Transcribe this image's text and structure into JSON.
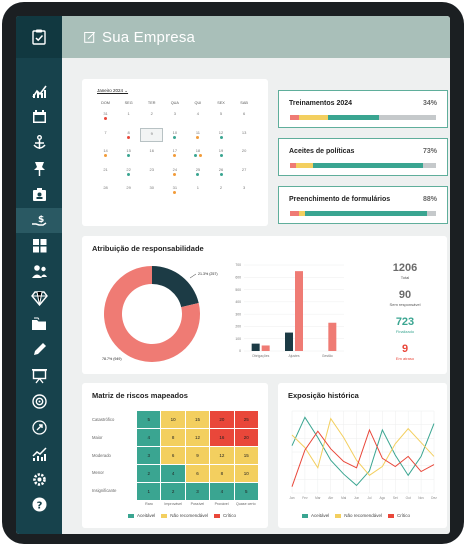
{
  "app": {
    "title": "Sua Empresa"
  },
  "colors": {
    "teal": "#3aa591",
    "dark": "#1c3b45",
    "coral": "#ef7b74",
    "yellow": "#f3cf5f",
    "red": "#e9473a",
    "orange": "#f29b39",
    "grey": "#c5c9cb",
    "sidebar": "#17424c"
  },
  "sidebar": {
    "items": [
      {
        "icon": "bar-chart-icon"
      },
      {
        "icon": "calendar-icon"
      },
      {
        "icon": "anchor-icon"
      },
      {
        "icon": "pin-icon"
      },
      {
        "icon": "id-badge-icon"
      },
      {
        "icon": "hand-money-icon"
      },
      {
        "icon": "grid-icon"
      },
      {
        "icon": "users-icon"
      },
      {
        "icon": "diamond-icon"
      },
      {
        "icon": "folders-icon"
      },
      {
        "icon": "pen-icon"
      },
      {
        "icon": "presentation-icon"
      },
      {
        "icon": "target-icon"
      },
      {
        "icon": "rocket-icon"
      },
      {
        "icon": "analytics-icon"
      },
      {
        "icon": "settings-icon"
      },
      {
        "icon": "help-icon"
      }
    ]
  },
  "calendar": {
    "month_label": "Janeiro 2024",
    "weekdays": [
      "DOM",
      "SEG",
      "TER",
      "QUA",
      "QUI",
      "SEX",
      "SAB"
    ],
    "weeks": [
      [
        {
          "d": "31",
          "m": [
            "#e9473a"
          ]
        },
        {
          "d": "1"
        },
        {
          "d": "2"
        },
        {
          "d": "3"
        },
        {
          "d": "4"
        },
        {
          "d": "5"
        },
        {
          "d": "6"
        }
      ],
      [
        {
          "d": "7"
        },
        {
          "d": "8",
          "m": [
            "#e9473a"
          ]
        },
        {
          "d": "9",
          "sel": true
        },
        {
          "d": "10",
          "m": [
            "#3aa591"
          ]
        },
        {
          "d": "11",
          "m": [
            "#f29b39"
          ]
        },
        {
          "d": "12",
          "m": [
            "#3aa591"
          ]
        },
        {
          "d": "13"
        }
      ],
      [
        {
          "d": "14",
          "m": [
            "#f29b39"
          ]
        },
        {
          "d": "15",
          "m": [
            "#3aa591"
          ]
        },
        {
          "d": "16"
        },
        {
          "d": "17",
          "m": [
            "#f29b39"
          ]
        },
        {
          "d": "18",
          "m": [
            "#3aa591",
            "#f29b39"
          ]
        },
        {
          "d": "19",
          "m": [
            "#3aa591"
          ]
        },
        {
          "d": "20"
        }
      ],
      [
        {
          "d": "21"
        },
        {
          "d": "22",
          "m": [
            "#3aa591"
          ]
        },
        {
          "d": "23"
        },
        {
          "d": "24",
          "m": [
            "#f29b39"
          ]
        },
        {
          "d": "25",
          "m": [
            "#3aa591"
          ]
        },
        {
          "d": "26",
          "m": [
            "#3aa591"
          ]
        },
        {
          "d": "27"
        }
      ],
      [
        {
          "d": "28"
        },
        {
          "d": "29"
        },
        {
          "d": "30"
        },
        {
          "d": "31",
          "m": [
            "#f29b39"
          ]
        },
        {
          "d": "1"
        },
        {
          "d": "2"
        },
        {
          "d": "3"
        }
      ]
    ]
  },
  "progress": [
    {
      "title": "Treinamentos 2024",
      "percent": "34%",
      "segments": [
        {
          "c": "#ef7b74",
          "v": 6
        },
        {
          "c": "#f3cf5f",
          "v": 20
        },
        {
          "c": "#3aa591",
          "v": 35
        },
        {
          "c": "#c5c9cb",
          "v": 39
        }
      ]
    },
    {
      "title": "Aceites de políticas",
      "percent": "73%",
      "segments": [
        {
          "c": "#ef7b74",
          "v": 4
        },
        {
          "c": "#f3cf5f",
          "v": 12
        },
        {
          "c": "#3aa591",
          "v": 75
        },
        {
          "c": "#c5c9cb",
          "v": 9
        }
      ]
    },
    {
      "title": "Preenchimento de formulários",
      "percent": "88%",
      "segments": [
        {
          "c": "#ef7b74",
          "v": 6
        },
        {
          "c": "#f3cf5f",
          "v": 4
        },
        {
          "c": "#3aa591",
          "v": 84
        },
        {
          "c": "#c5c9cb",
          "v": 6
        }
      ]
    }
  ],
  "responsibility": {
    "title": "Atribuição de responsabilidade",
    "stats": [
      {
        "value": "1206",
        "label": "Total",
        "color": "#6b6b6b"
      },
      {
        "value": "90",
        "label": "Sem responsável",
        "color": "#6b6b6b"
      },
      {
        "value": "723",
        "label": "Finalizado",
        "color": "#3aa591"
      },
      {
        "value": "9",
        "label": "Em atraso",
        "color": "#e9473a"
      }
    ]
  },
  "chart_data": [
    {
      "type": "pie",
      "title": "",
      "slices": [
        {
          "label": "21.3% (257)",
          "value": 21.3,
          "color": "#1c3b45"
        },
        {
          "label": "78.7% (949)",
          "value": 78.7,
          "color": "#ef7b74"
        }
      ]
    },
    {
      "type": "bar",
      "categories": [
        "Obrigações",
        "Ajustes",
        "Gestão"
      ],
      "series": [
        {
          "values": [
            60,
            150,
            0
          ],
          "color": "#1c3b45"
        },
        {
          "values": [
            45,
            650,
            230
          ],
          "color": "#ef7b74"
        }
      ],
      "yticks": [
        "700",
        "600",
        "500",
        "400",
        "300",
        "200",
        "100",
        "0"
      ],
      "ylim": [
        0,
        700
      ]
    },
    {
      "type": "line",
      "title": "Exposição histórica",
      "categories": [
        "Jan",
        "Fev",
        "Mar",
        "Abr",
        "Mai",
        "Jun",
        "Jul",
        "Ago",
        "Set",
        "Out",
        "Nov",
        "Dez"
      ],
      "series": [
        {
          "name": "Aceitável",
          "color": "#3aa591",
          "values": [
            75,
            120,
            88,
            52,
            30,
            12,
            35,
            100,
            60,
            28,
            58,
            110
          ]
        },
        {
          "name": "Não recomendável",
          "color": "#f3cf5f",
          "values": [
            92,
            72,
            40,
            118,
            88,
            52,
            28,
            42,
            78,
            102,
            80,
            58
          ]
        },
        {
          "name": "Crítico",
          "color": "#e9473a",
          "values": [
            10,
            68,
            98,
            70,
            50,
            40,
            100,
            55,
            42,
            58,
            34,
            45
          ]
        }
      ],
      "ylim": [
        0,
        130
      ]
    }
  ],
  "risk_matrix": {
    "title": "Matriz de riscos mapeados",
    "rows": [
      "Catastrófico",
      "Maior",
      "Moderado",
      "Menor",
      "Insignificante"
    ],
    "cols": [
      "Raro",
      "Improvável",
      "Possível",
      "Provável",
      "Quase certo"
    ],
    "cells": [
      [
        {
          "v": "5",
          "c": "#3aa591"
        },
        {
          "v": "10",
          "c": "#f3cf5f"
        },
        {
          "v": "15",
          "c": "#f3cf5f"
        },
        {
          "v": "20",
          "c": "#e9473a"
        },
        {
          "v": "25",
          "c": "#e9473a"
        }
      ],
      [
        {
          "v": "4",
          "c": "#3aa591"
        },
        {
          "v": "8",
          "c": "#f3cf5f"
        },
        {
          "v": "12",
          "c": "#f3cf5f"
        },
        {
          "v": "16",
          "c": "#e9473a"
        },
        {
          "v": "20",
          "c": "#e9473a"
        }
      ],
      [
        {
          "v": "3",
          "c": "#3aa591"
        },
        {
          "v": "6",
          "c": "#f3cf5f"
        },
        {
          "v": "9",
          "c": "#f3cf5f"
        },
        {
          "v": "12",
          "c": "#f3cf5f"
        },
        {
          "v": "15",
          "c": "#f3cf5f"
        }
      ],
      [
        {
          "v": "2",
          "c": "#3aa591"
        },
        {
          "v": "4",
          "c": "#3aa591"
        },
        {
          "v": "6",
          "c": "#f3cf5f"
        },
        {
          "v": "8",
          "c": "#f3cf5f"
        },
        {
          "v": "10",
          "c": "#f3cf5f"
        }
      ],
      [
        {
          "v": "1",
          "c": "#3aa591"
        },
        {
          "v": "2",
          "c": "#3aa591"
        },
        {
          "v": "3",
          "c": "#3aa591"
        },
        {
          "v": "4",
          "c": "#3aa591"
        },
        {
          "v": "5",
          "c": "#3aa591"
        }
      ]
    ],
    "legend": [
      {
        "label": "Aceitável",
        "color": "#3aa591"
      },
      {
        "label": "Não recomendável",
        "color": "#f3cf5f"
      },
      {
        "label": "Crítico",
        "color": "#e9473a"
      }
    ]
  },
  "history_legend": [
    {
      "label": "Aceitável",
      "color": "#3aa591"
    },
    {
      "label": "Não recomendável",
      "color": "#f3cf5f"
    },
    {
      "label": "Crítico",
      "color": "#e9473a"
    }
  ],
  "history_title": "Exposição histórica"
}
